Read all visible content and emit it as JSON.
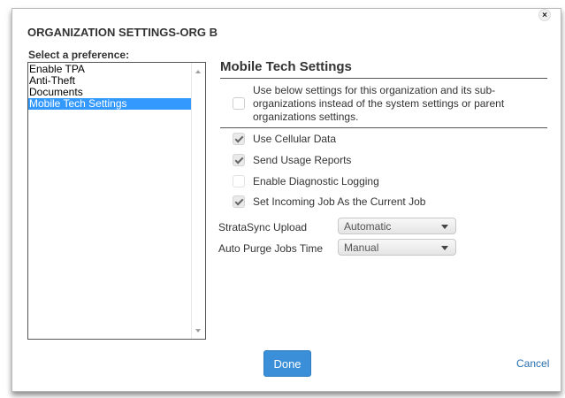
{
  "dialog": {
    "title": "ORGANIZATION SETTINGS-ORG B",
    "close_icon": "close-icon",
    "close_glyph": "×"
  },
  "preferences": {
    "label": "Select a preference:",
    "items": [
      {
        "label": "Enable TPA",
        "selected": false
      },
      {
        "label": "Anti-Theft",
        "selected": false
      },
      {
        "label": "Documents",
        "selected": false
      },
      {
        "label": "Mobile Tech Settings",
        "selected": true
      }
    ],
    "selected_color": "#3399ff"
  },
  "mobile_tech": {
    "title": "Mobile Tech Settings",
    "override": {
      "checked": false,
      "text": "Use below settings for this organization and its sub-organizations instead of the system settings or parent organizations settings."
    },
    "options": [
      {
        "label": "Use Cellular Data",
        "checked": true
      },
      {
        "label": "Send Usage Reports",
        "checked": true
      },
      {
        "label": "Enable Diagnostic Logging",
        "checked": false
      },
      {
        "label": "Set Incoming Job As the Current Job",
        "checked": true
      }
    ],
    "stratasync_upload": {
      "label": "StrataSync Upload",
      "value": "Automatic"
    },
    "auto_purge": {
      "label": "Auto Purge Jobs Time",
      "value": "Manual"
    }
  },
  "footer": {
    "done_label": "Done",
    "cancel_label": "Cancel",
    "done_color": "#3a8fd8",
    "cancel_color": "#2a6fb0"
  }
}
